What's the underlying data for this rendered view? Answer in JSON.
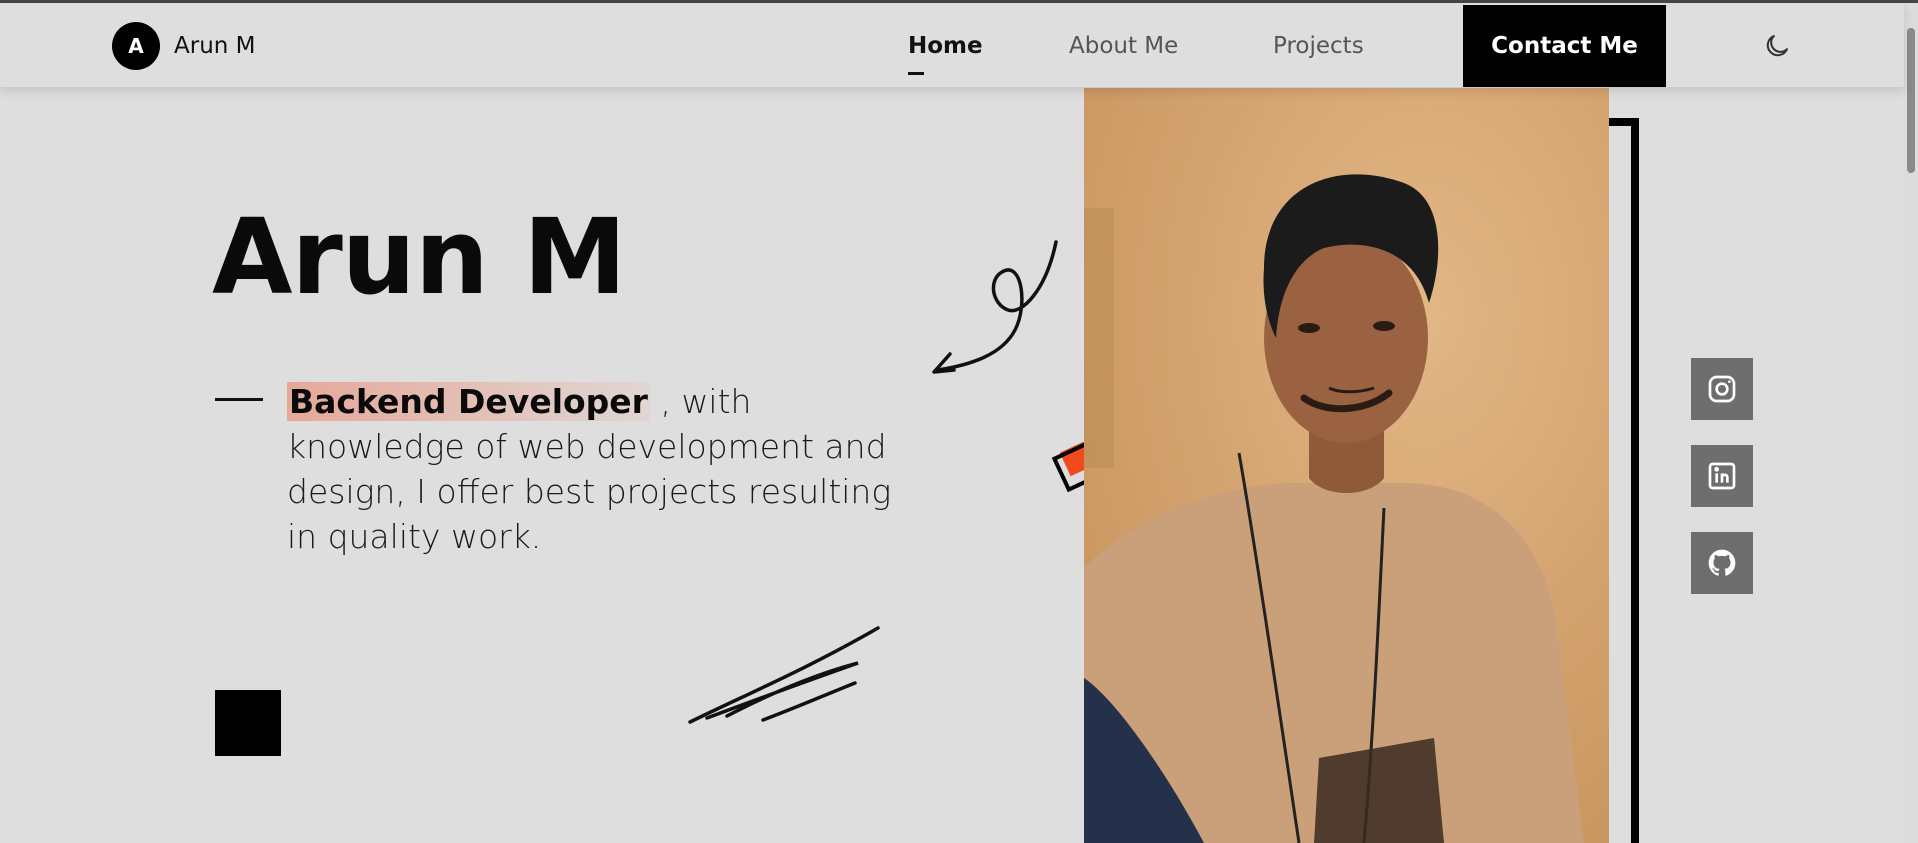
{
  "nav": {
    "logo_letter": "A",
    "logo_name": "Arun M",
    "links": [
      {
        "label": "Home",
        "active": true
      },
      {
        "label": "About Me",
        "active": false
      },
      {
        "label": "Projects",
        "active": false
      }
    ],
    "contact_label": "Contact Me",
    "theme_icon": "moon-icon"
  },
  "hero": {
    "name": "Arun M",
    "role": "Backend Developer",
    "description": " , with knowledge of web development and design, I offer best projects resulting in quality work."
  },
  "photo": {
    "subject": "portrait-photo"
  },
  "social": [
    {
      "icon": "instagram-icon"
    },
    {
      "icon": "linkedin-icon"
    },
    {
      "icon": "github-icon"
    }
  ],
  "colors": {
    "background": "#dedede",
    "accent": "#f04a1d",
    "highlight": "#e99682",
    "primary": "#000000",
    "social_bg": "#6e6e6e"
  }
}
